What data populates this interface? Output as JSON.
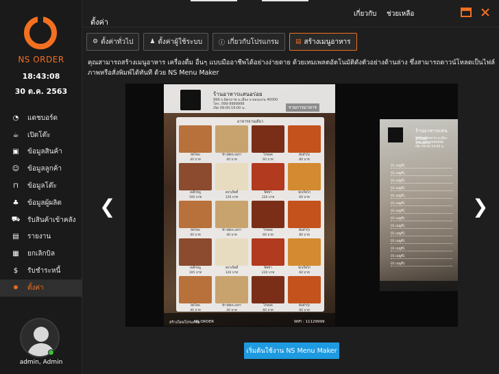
{
  "app": {
    "brand": "NS ORDER",
    "time": "18:43:08",
    "date": "30 ต.ค. 2563",
    "user": "admin, Admin"
  },
  "sidebar": {
    "items": [
      {
        "label": "แดชบอร์ด",
        "icon": "dashboard-icon",
        "glyph": "◔"
      },
      {
        "label": "เปิดโต๊ะ",
        "icon": "cup-icon",
        "glyph": "☕"
      },
      {
        "label": "ข้อมูลสินค้า",
        "icon": "shopping-bag-icon",
        "glyph": "▣"
      },
      {
        "label": "ข้อมูลลูกค้า",
        "icon": "users-icon",
        "glyph": "☺"
      },
      {
        "label": "ข้อมูลโต๊ะ",
        "icon": "table-icon",
        "glyph": "⊓"
      },
      {
        "label": "ข้อมูลผู้ผลิต",
        "icon": "group-icon",
        "glyph": "♣"
      },
      {
        "label": "รับสินค้าเข้าคลัง",
        "icon": "cart-icon",
        "glyph": "⛟"
      },
      {
        "label": "รายงาน",
        "icon": "report-icon",
        "glyph": "▤"
      },
      {
        "label": "ยกเลิกบิล",
        "icon": "cancel-bill-icon",
        "glyph": "▦"
      },
      {
        "label": "รับชำระหนี้",
        "icon": "dollar-icon",
        "glyph": "$"
      },
      {
        "label": "ตั้งค่า",
        "icon": "gear-icon",
        "glyph": "✹"
      }
    ],
    "active_index": 10
  },
  "topbar": {
    "title": "ตั้งค่า",
    "about": "เกี่ยวกับ",
    "help": "ช่วยเหลือ"
  },
  "tabs": [
    {
      "label": "ตั้งค่าทั่วไป",
      "icon": "gear-icon",
      "glyph": "⚙"
    },
    {
      "label": "ตั้งค่าผู้ใช้ระบบ",
      "icon": "users-icon",
      "glyph": "♟"
    },
    {
      "label": "เกี่ยวกับโปรแกรม",
      "icon": "info-icon",
      "glyph": "ⓘ"
    },
    {
      "label": "สร้างเมนูอาหาร",
      "icon": "menu-book-icon",
      "glyph": "▤"
    }
  ],
  "description": "คุณสามารถสร้างเมนูอาหาร เครื่องดื่ม อื่นๆ แบบมืออาชีพได้อย่างง่ายดาย ด้วยเทมเพลตอัตโนมัติดังตัวอย่างด้านล่าง ซึ่งสามารถดาวน์โหลดเป็นไฟล์ภาพหรือสั่งพิมพ์ได้ทันที ด้วย NS Menu Maker",
  "preview": {
    "card1": {
      "restaurant": "ร้านอาหารแสนอร่อย",
      "address": "999 ถ.มิตรภาพ อ.เมือง จ.ขอนแก่น 40000",
      "phone": "โทร. 099-9999999",
      "hours": "เปิด 09:00-19:00 น.",
      "badge": "รายการอาหาร",
      "section": "อาหารจานเดียว",
      "dishes": [
        {
          "name": "ผัดไทย",
          "price": "40 บาท",
          "color": "#b8713b"
        },
        {
          "name": "ข้าวผัดกะเพรา",
          "price": "40 บาท",
          "color": "#c8a36d"
        },
        {
          "name": "ไก่ทอด",
          "price": "60 บาท",
          "color": "#7a2e18"
        },
        {
          "name": "ต้มยำกุ้ง",
          "price": "80 บาท",
          "color": "#c3521d"
        },
        {
          "name": "สเต็กหมู",
          "price": "195 บาท",
          "color": "#8c4a2e"
        },
        {
          "name": "สปาเก็ตตี้",
          "price": "120 บาท",
          "color": "#e8dcc0"
        },
        {
          "name": "พิซซ่า",
          "price": "220 บาท",
          "color": "#b23a1e"
        },
        {
          "name": "นักเก็ตไก่",
          "price": "60 บาท",
          "color": "#d38a30"
        }
      ],
      "footer_left": "สร้างโดยโปรแกรม",
      "footer_brand": "NS ORDER",
      "footer_right": "WiFi : 11129999"
    },
    "card2": {
      "restaurant": "ร้านอาหารแสนอร่อย",
      "address": "999 ถ.มิตรภาพ อ.เมือง จ.ขอนแก่น",
      "phone": "โทร. 099-9999999",
      "hours": "เปิด 09:00-19:00 น.",
      "item_label": "01 เมนูที่1"
    }
  },
  "start_button": "เริ่มต้นใช้งาน NS Menu Maker",
  "colors": {
    "accent": "#f37021",
    "button": "#1e9ae0",
    "sidebar": "#1a1a1a"
  }
}
